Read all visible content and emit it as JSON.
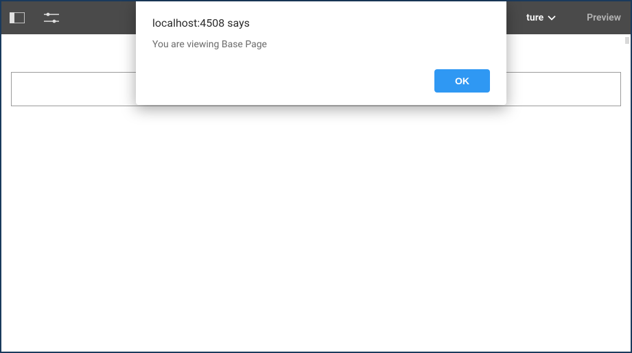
{
  "toolbar": {
    "structure_label": "ture",
    "preview_label": "Preview"
  },
  "dialog": {
    "title": "localhost:4508 says",
    "message": "You are viewing Base Page",
    "ok_label": "OK"
  }
}
